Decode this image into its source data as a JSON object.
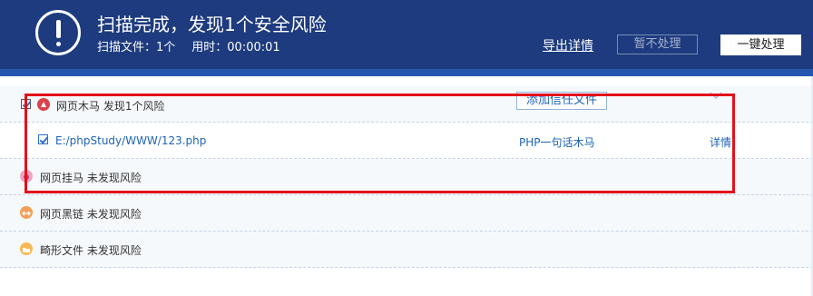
{
  "header": {
    "title": "扫描完成，发现1个安全风险",
    "files_label": "扫描文件：1个",
    "time_label": "用时：00:00:01",
    "export_label": "导出详情",
    "ignore_label": "暂不处理",
    "onekey_label": "一键处理"
  },
  "categories": [
    {
      "label": "网页木马 发现1个风险",
      "trust_label": "添加信任文件",
      "icon": "trojan-icon"
    },
    {
      "label": "网页挂马 未发现风险",
      "icon": "hanging-horse-icon"
    },
    {
      "label": "网页黑链 未发现风险",
      "icon": "dark-link-icon"
    },
    {
      "label": "畸形文件 未发现风险",
      "icon": "folder-icon"
    }
  ],
  "file": {
    "path": "E:/phpStudy/WWW/123.php",
    "type": "PHP一句话木马",
    "detail_label": "详情"
  },
  "colors": {
    "header_bg": "#1d3b7e",
    "link_blue": "#1e63b8",
    "highlight_red": "#e3101a"
  }
}
